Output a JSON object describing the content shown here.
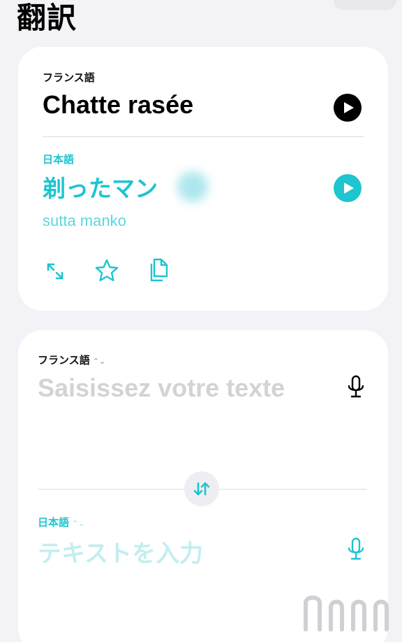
{
  "header": {
    "title": "翻訳"
  },
  "result_card": {
    "source_language": "フランス語",
    "source_text": "Chatte rasée",
    "target_language": "日本語",
    "target_text": "剃ったマン",
    "romanization": "sutta manko",
    "actions": [
      "expand-icon",
      "star-icon",
      "copy-icon"
    ],
    "play_icon": "play-icon"
  },
  "input_card": {
    "source_language": "フランス語",
    "source_placeholder": "Saisissez votre texte",
    "target_language": "日本語",
    "target_placeholder": "テキストを入力",
    "swap_icon": "swap-icon",
    "mic_icon": "microphone-icon"
  },
  "colors": {
    "accent": "#1cc5cf",
    "background": "#f2f2f7",
    "card": "#ffffff"
  }
}
